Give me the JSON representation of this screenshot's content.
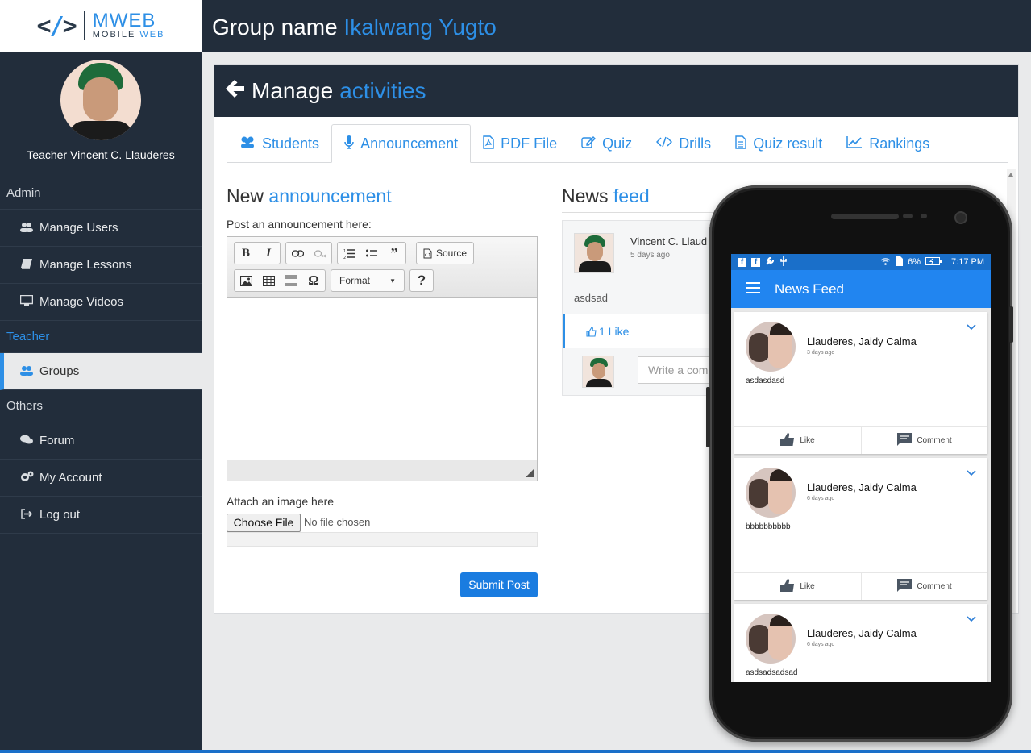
{
  "brand": {
    "mark": "</>",
    "name_main": "MWEB",
    "name_sub_a": "MOBILE",
    "name_sub_b": "WEB"
  },
  "sidebar": {
    "profile_name": "Teacher Vincent C. Llauderes",
    "sections": [
      {
        "label": "Admin",
        "items": [
          {
            "label": "Manage Users",
            "icon": "users-icon"
          },
          {
            "label": "Manage Lessons",
            "icon": "book-icon"
          },
          {
            "label": "Manage Videos",
            "icon": "monitor-icon"
          }
        ]
      },
      {
        "label": "Teacher",
        "items": [
          {
            "label": "Groups",
            "icon": "users-icon",
            "selected": true
          }
        ]
      },
      {
        "label": "Others",
        "items": [
          {
            "label": "Forum",
            "icon": "comments-icon"
          },
          {
            "label": "My Account",
            "icon": "cogs-icon"
          },
          {
            "label": "Log out",
            "icon": "logout-icon"
          }
        ]
      }
    ]
  },
  "header": {
    "prefix": "Group name",
    "group": "Ikalwang Yugto"
  },
  "panel": {
    "title_a": "Manage",
    "title_b": "activities",
    "tabs": [
      {
        "label": "Students",
        "icon": "users-icon"
      },
      {
        "label": "Announcement",
        "icon": "microphone-icon",
        "active": true
      },
      {
        "label": "PDF File",
        "icon": "pdf-icon"
      },
      {
        "label": "Quiz",
        "icon": "edit-icon"
      },
      {
        "label": "Drills",
        "icon": "code-icon"
      },
      {
        "label": "Quiz result",
        "icon": "file-text-icon"
      },
      {
        "label": "Rankings",
        "icon": "line-chart-icon"
      }
    ]
  },
  "announcement": {
    "title_a": "New",
    "title_b": "announcement",
    "post_label": "Post an announcement here:",
    "editor": {
      "source_label": "Source",
      "format_label": "Format",
      "help_label": "?"
    },
    "attach_label": "Attach an image here",
    "choose_file": "Choose File",
    "no_file": "No file chosen",
    "submit": "Submit Post"
  },
  "news_feed": {
    "title_a": "News",
    "title_b": "feed",
    "author": "Vincent C. Llaud",
    "time": "5 days ago",
    "body": "asdsad",
    "likes": "1 Like",
    "comment_placeholder": "Write a com"
  },
  "phone": {
    "status": {
      "battery": "6%",
      "time": "7:17 PM"
    },
    "app_title": "News Feed",
    "posts": [
      {
        "name": "Llauderes, Jaidy Calma",
        "time": "3 days ago",
        "body": "asdasdasd"
      },
      {
        "name": "Llauderes, Jaidy Calma",
        "time": "6 days ago",
        "body": "bbbbbbbbbb"
      },
      {
        "name": "Llauderes, Jaidy Calma",
        "time": "6 days ago",
        "body": "asdsadsadsad"
      }
    ],
    "like_label": "Like",
    "comment_label": "Comment"
  },
  "colors": {
    "accent": "#2d8fe6",
    "dark": "#222d3b",
    "app_bar": "#2185f0"
  }
}
